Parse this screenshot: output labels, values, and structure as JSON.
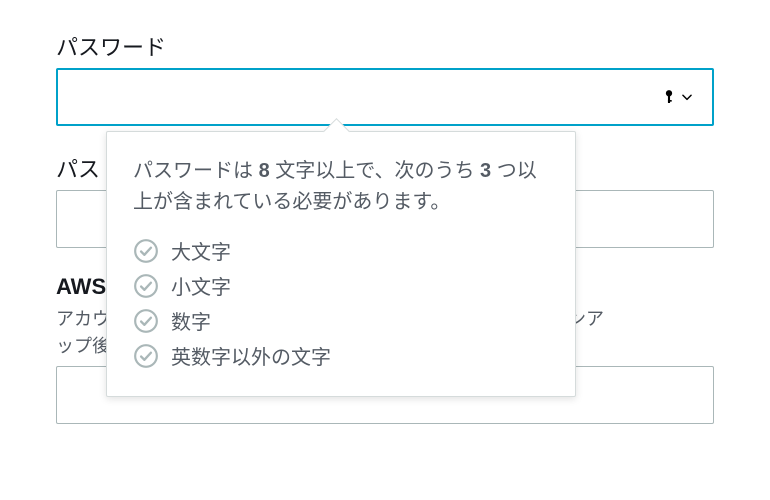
{
  "fields": {
    "password": {
      "label": "パスワード",
      "value": ""
    },
    "confirm": {
      "label_partial": "パス",
      "value": ""
    },
    "account": {
      "label_partial": "AWS",
      "sublabel_prefix": "アカウ",
      "sublabel_right": "インア",
      "sublabel_line2": "ップ後",
      "value": ""
    }
  },
  "popover": {
    "text_parts": {
      "p1": "パスワードは ",
      "num1": "8",
      "p2": " 文字以上で、次のうち ",
      "num2": "3",
      "p3": " つ以上が含まれている必要があります。"
    },
    "requirements": [
      "大文字",
      "小文字",
      "数字",
      "英数字以外の文字"
    ]
  }
}
